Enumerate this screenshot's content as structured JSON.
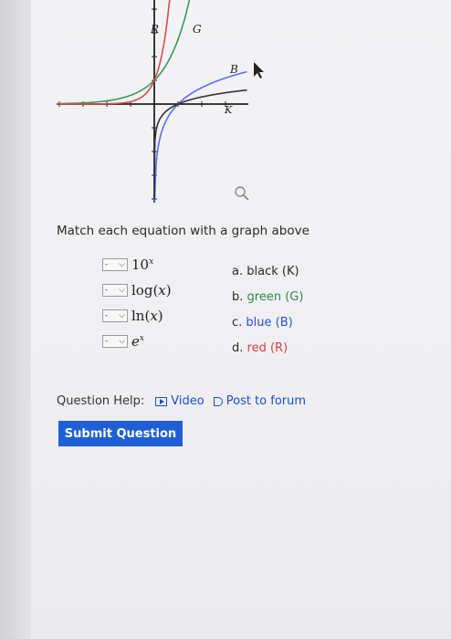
{
  "graph": {
    "curve_labels": {
      "red": "R",
      "green": "G",
      "blue": "B",
      "black": "K"
    },
    "colors": {
      "red": "#d64c4c",
      "green": "#3a9a5a",
      "blue": "#5a6ef0",
      "black": "#333333",
      "axis": "#222222"
    }
  },
  "prompt": "Match each equation with a graph above",
  "equations": [
    {
      "select_value": "-",
      "base": "10",
      "sup": "x"
    },
    {
      "select_value": "-",
      "fn": "log",
      "arg": "x"
    },
    {
      "select_value": "-",
      "fn": "ln",
      "arg": "x"
    },
    {
      "select_value": "-",
      "base": "e",
      "sup": "x"
    }
  ],
  "options": [
    {
      "letter": "a.",
      "text": "black (K)",
      "color": "#2a2a2a"
    },
    {
      "letter": "b.",
      "text": "green (G)",
      "color": "#2f8a4a"
    },
    {
      "letter": "c.",
      "text": "blue (B)",
      "color": "#2e4fd6"
    },
    {
      "letter": "d.",
      "text": "red (R)",
      "color": "#d64040"
    }
  ],
  "help": {
    "label": "Question Help:",
    "video": "Video",
    "forum": "Post to forum"
  },
  "submit_label": "Submit Question"
}
